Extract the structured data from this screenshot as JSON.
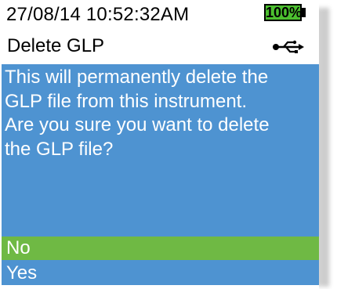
{
  "status": {
    "datetime": "27/08/14  10:52:32AM",
    "battery": "100%"
  },
  "header": {
    "title": "Delete GLP",
    "usb_icon": "usb-icon"
  },
  "dialog": {
    "message": "This will permanently delete the\nGLP file from this instrument.\nAre you sure you want to delete\nthe GLP file?",
    "options": {
      "no": "No",
      "yes": "Yes"
    }
  },
  "colors": {
    "panel_blue": "#4e93d1",
    "selected_green": "#6fb944",
    "battery_green": "#4cbf2f"
  }
}
